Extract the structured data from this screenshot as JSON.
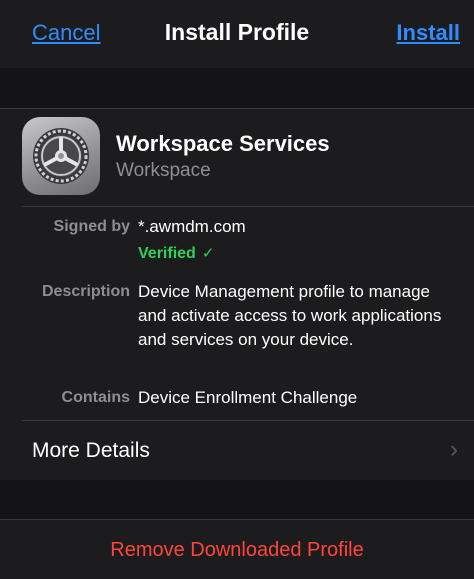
{
  "nav": {
    "cancel_label": "Cancel",
    "title": "Install Profile",
    "install_label": "Install"
  },
  "profile": {
    "icon": "settings-gear-icon",
    "name": "Workspace Services",
    "organization": "Workspace"
  },
  "details": {
    "signed_by_label": "Signed by",
    "signed_by_value": "*.awmdm.com",
    "verified_label": "Verified",
    "verified_icon": "checkmark-icon",
    "description_label": "Description",
    "description_value": "Device Management profile to manage and activate access to work applications and services on your device.",
    "contains_label": "Contains",
    "contains_value": "Device Enrollment Challenge"
  },
  "more_details": {
    "label": "More Details",
    "icon": "chevron-right-icon"
  },
  "remove": {
    "label": "Remove Downloaded Profile"
  },
  "colors": {
    "accent_blue": "#2f8cff",
    "verified_green": "#30d158",
    "destructive_red": "#ff453a",
    "background": "#000000",
    "card": "#1c1c1e"
  }
}
